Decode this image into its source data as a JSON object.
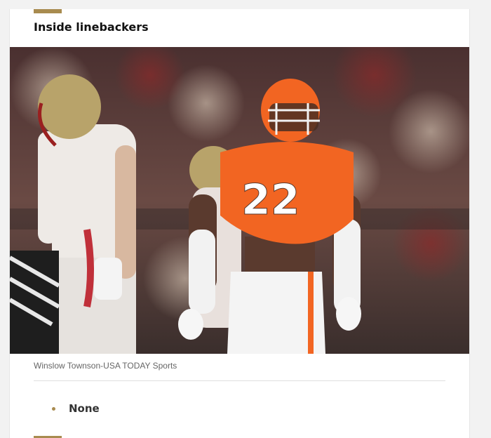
{
  "section": {
    "title": "Inside linebackers"
  },
  "photo": {
    "alt": "Clemson linebacker wearing number 22 smiling on the field",
    "jersey_number": "22",
    "credit": "Winslow Townson-USA TODAY Sports"
  },
  "list": {
    "items": [
      {
        "label": "None"
      }
    ]
  },
  "colors": {
    "accent": "#a88b4f",
    "clemson_orange": "#f26522",
    "opponent_gold": "#b8a36a"
  }
}
